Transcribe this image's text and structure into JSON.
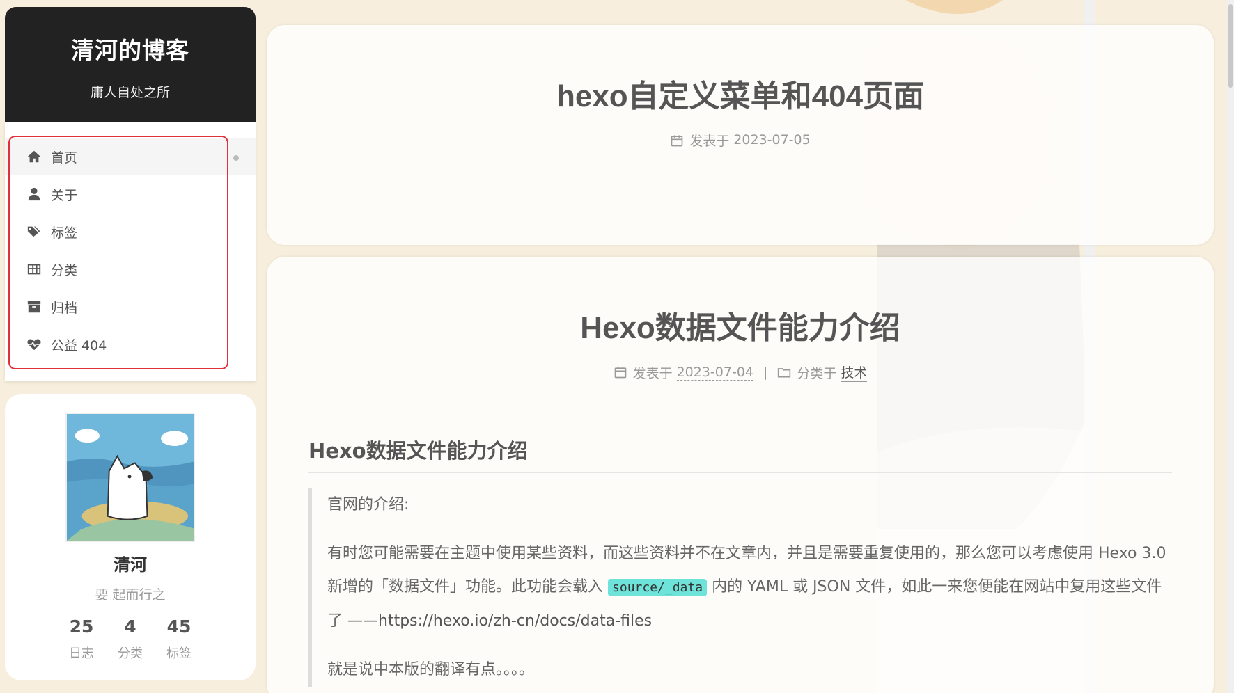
{
  "site": {
    "title": "清河的博客",
    "subtitle": "庸人自处之所"
  },
  "menu": {
    "items": [
      {
        "label": "首页",
        "icon": "home-icon",
        "active": true
      },
      {
        "label": "关于",
        "icon": "user-icon"
      },
      {
        "label": "标签",
        "icon": "tags-icon"
      },
      {
        "label": "分类",
        "icon": "th-icon"
      },
      {
        "label": "归档",
        "icon": "archive-icon"
      },
      {
        "label": "公益 404",
        "icon": "heartbeat-icon"
      }
    ]
  },
  "author": {
    "name": "清河",
    "description": "要 起而行之",
    "stats": [
      {
        "count": "25",
        "label": "日志"
      },
      {
        "count": "4",
        "label": "分类"
      },
      {
        "count": "45",
        "label": "标签"
      }
    ]
  },
  "posts": [
    {
      "title": "hexo自定义菜单和404页面",
      "posted_label": "发表于",
      "date": "2023-07-05"
    },
    {
      "title": "Hexo数据文件能力介绍",
      "posted_label": "发表于",
      "date": "2023-07-04",
      "separator": "|",
      "category_label": "分类于",
      "category": "技术",
      "heading": "Hexo数据文件能力介绍",
      "quote_intro": "官网的介绍:",
      "quote_p1_a": "有时您可能需要在主题中使用某些资料，而这些资料并不在文章内，并且是需要重复使用的，那么您可以考虑使用 Hexo 3.0 新增的「数据文件」功能。此功能会载入",
      "quote_code": "source/_data",
      "quote_p1_b": "内的 YAML 或 JSON 文件，如此一来您便能在网站中复用这些文件了 ——",
      "quote_link": "https://hexo.io/zh-cn/docs/data-files",
      "quote_p2": "就是说中本版的翻译有点。。。。"
    }
  ],
  "colors": {
    "background": "#f7eedd",
    "brand_bg": "#222222",
    "highlight_box": "#e0303a",
    "code_bg": "#6ee3d9"
  }
}
